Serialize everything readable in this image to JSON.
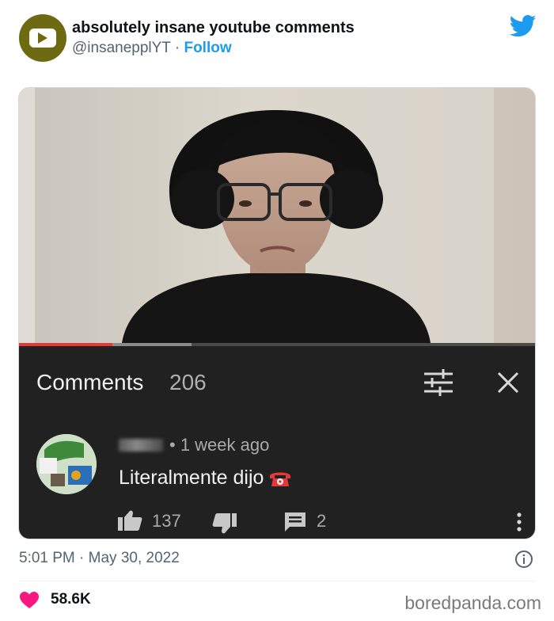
{
  "tweet": {
    "account_name": "absolutely insane youtube comments",
    "handle": "@insanepplYT",
    "separator": "·",
    "follow_label": "Follow",
    "timestamp": "5:01 PM · May 30, 2022",
    "like_total": "58.6K",
    "accent_color": "#1d9bf0",
    "heart_color": "#f91880"
  },
  "youtube": {
    "progress": 0.18,
    "comments_label": "Comments",
    "comments_count": "206",
    "comment": {
      "time_ago": "• 1 week ago",
      "text": "Literalmente dijo",
      "emoji_icon": "telephone-icon",
      "likes": "137",
      "replies": "2"
    }
  },
  "watermark": "boredpanda.com"
}
